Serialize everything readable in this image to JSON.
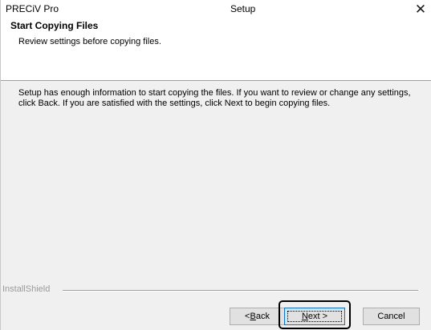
{
  "titlebar": {
    "app_name": "PRECiV Pro",
    "title": "Setup",
    "close_glyph": "✕"
  },
  "header": {
    "title": "Start Copying Files",
    "subtitle": "Review settings before copying files."
  },
  "body": {
    "text": "Setup has enough information to start copying the files. If you want to review or change any settings, click Back. If you are satisfied with the settings, click Next to begin copying files."
  },
  "footer": {
    "brand": "InstallShield"
  },
  "buttons": {
    "back_prefix": "< ",
    "back_mnemonic": "B",
    "back_rest": "ack",
    "next_mnemonic": "N",
    "next_rest": "ext >",
    "cancel": "Cancel"
  },
  "icons": {
    "close": "close-icon"
  },
  "colors": {
    "focus_border": "#0078d7",
    "highlight": "#000000"
  }
}
